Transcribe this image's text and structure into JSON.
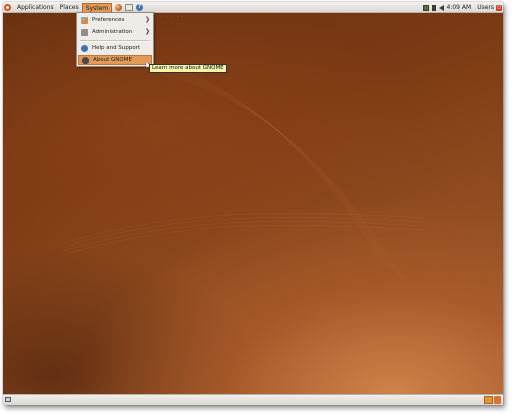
{
  "top_panel": {
    "menus": {
      "applications": "Applications",
      "places": "Places",
      "system": "System"
    },
    "clock": "4:09 AM",
    "user": "Users"
  },
  "system_menu": {
    "items": [
      {
        "label": "Preferences",
        "icon": "preferences-icon",
        "has_submenu": true
      },
      {
        "label": "Administration",
        "icon": "administration-icon",
        "has_submenu": true
      },
      {
        "label": "Help and Support",
        "icon": "help-icon",
        "has_submenu": false
      },
      {
        "label": "About GNOME",
        "icon": "gnome-foot-icon",
        "has_submenu": false,
        "highlighted": true
      }
    ]
  },
  "tooltip": "Learn more about GNOME",
  "colors": {
    "menu_highlight": "#e29a56",
    "panel": "#e6e3de",
    "desktop": "#7c3a14"
  }
}
